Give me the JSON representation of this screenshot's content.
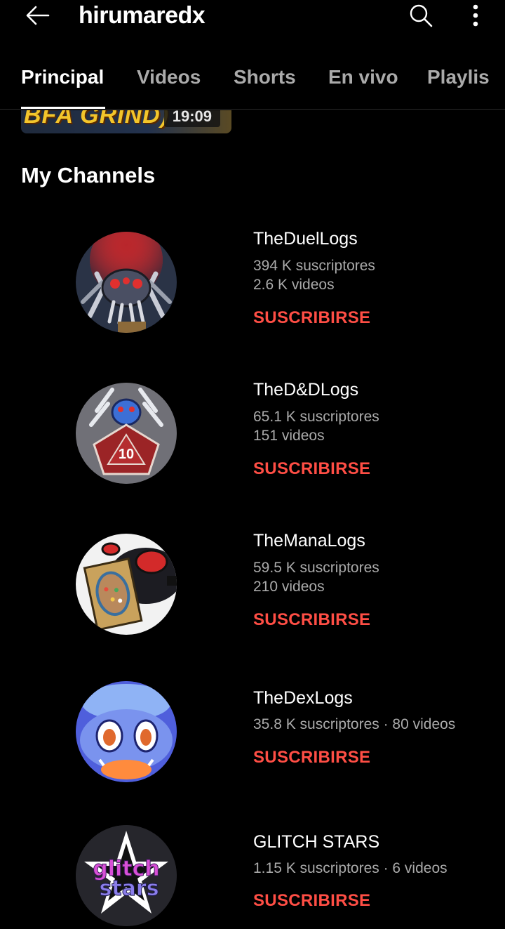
{
  "header": {
    "channel_name": "hirumaredx",
    "back_icon": "arrow-left-icon",
    "search_icon": "search-icon",
    "more_icon": "more-vertical-icon"
  },
  "tabs": [
    {
      "label": "Principal",
      "active": true
    },
    {
      "label": "Videos",
      "active": false
    },
    {
      "label": "Shorts",
      "active": false
    },
    {
      "label": "En vivo",
      "active": false
    },
    {
      "label": "Playlis",
      "active": false
    }
  ],
  "previous_video": {
    "thumbnail_text": "BFA GRIND)",
    "duration": "19:09"
  },
  "section": {
    "title": "My Channels"
  },
  "channels": [
    {
      "name": "TheDuelLogs",
      "subscribers": "394 K suscriptores",
      "videos": "2.6 K videos",
      "subscribe_label": "SUSCRIBIRSE"
    },
    {
      "name": "TheD&DLogs",
      "subscribers": "65.1 K suscriptores",
      "videos": "151 videos",
      "subscribe_label": "SUSCRIBIRSE"
    },
    {
      "name": "TheManaLogs",
      "subscribers": "59.5 K suscriptores",
      "videos": "210 videos",
      "subscribe_label": "SUSCRIBIRSE"
    },
    {
      "name": "TheDexLogs",
      "meta_line": "35.8 K suscriptores · 80 videos",
      "subscribe_label": "SUSCRIBIRSE"
    },
    {
      "name": "GLITCH STARS",
      "meta_line": "1.15 K suscriptores · 6 videos",
      "subscribe_label": "SUSCRIBIRSE"
    }
  ],
  "avatar_texts": {
    "dnd_die": "10",
    "glitch_line1": "glitch",
    "glitch_line2": "stars"
  },
  "colors": {
    "background": "#000000",
    "subscribe": "#ff4e45",
    "secondary_text": "#aaaaaa"
  }
}
